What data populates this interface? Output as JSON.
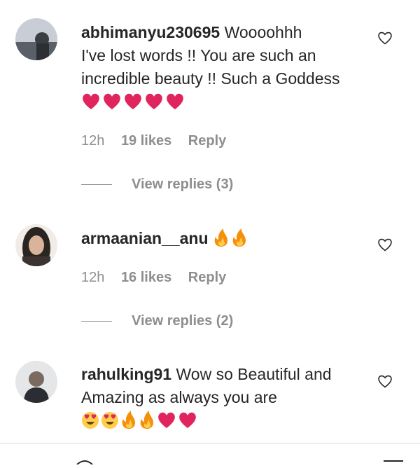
{
  "comments": [
    {
      "username": "abhimanyu230695",
      "text_line1": "Woooohhh",
      "text_rest": "I've lost words !! You are such an incredible beauty !! Such a Goddess",
      "emojis": [
        "red-heart",
        "red-heart",
        "red-heart",
        "red-heart",
        "red-heart"
      ],
      "time": "12h",
      "likes": "19 likes",
      "reply": "Reply",
      "view_replies": "View replies (3)"
    },
    {
      "username": "armaanian__anu",
      "emojis": [
        "fire",
        "fire"
      ],
      "time": "12h",
      "likes": "16 likes",
      "reply": "Reply",
      "view_replies": "View replies (2)"
    },
    {
      "username": "rahulking91",
      "text": "Wow so Beautiful and Amazing as always you are",
      "emojis": [
        "heart-eyes",
        "heart-eyes",
        "fire",
        "fire",
        "red-heart",
        "red-heart"
      ]
    }
  ],
  "colors": {
    "text": "#262626",
    "secondary": "#8e8e8e",
    "heart": "#e0245e",
    "fire": "#f4900c"
  }
}
